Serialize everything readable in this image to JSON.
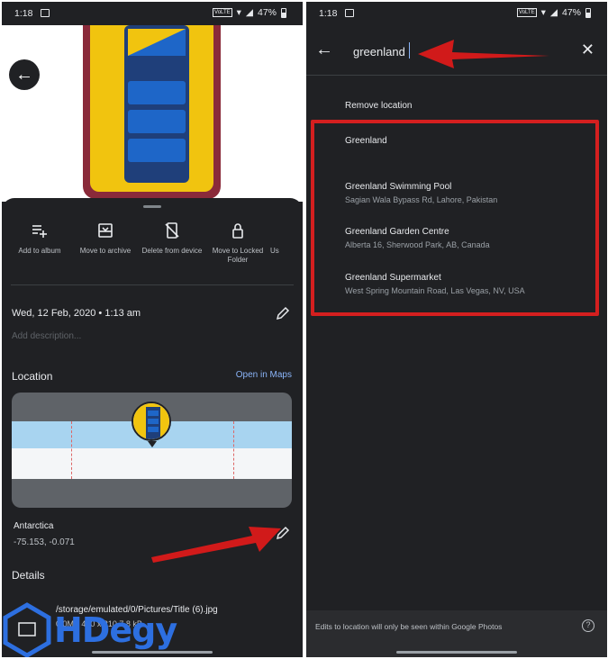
{
  "left_screen": {
    "status": {
      "time": "1:18",
      "battery": "47%",
      "chip": "VoLTE"
    },
    "actions": [
      {
        "label": "Add to album",
        "icon": "playlist-add-icon"
      },
      {
        "label": "Move to archive",
        "icon": "archive-icon"
      },
      {
        "label": "Delete from device",
        "icon": "delete-from-device-icon"
      },
      {
        "label": "Move to Locked Folder",
        "icon": "lock-icon"
      },
      {
        "label": "Us",
        "icon": "more-icon"
      }
    ],
    "date": "Wed, 12 Feb, 2020 • 1:13 am",
    "description_placeholder": "Add description...",
    "location_title": "Location",
    "open_maps": "Open in Maps",
    "location_name": "Antarctica",
    "location_coords": "-75.153, -0.071",
    "details_title": "Details",
    "file_path": "/storage/emulated/0/Pictures/Title (6).jpg",
    "file_meta": "0.0MP  410 x 210  7.8 kB"
  },
  "right_screen": {
    "status": {
      "time": "1:18",
      "battery": "47%",
      "chip": "VoLTE"
    },
    "search": {
      "value": "greenland"
    },
    "remove_location": "Remove location",
    "results": [
      {
        "name": "Greenland",
        "address": ""
      },
      {
        "name": "Greenland Swimming Pool",
        "address": "Sagian Wala Bypass Rd, Lahore, Pakistan"
      },
      {
        "name": "Greenland Garden Centre",
        "address": "Alberta 16, Sherwood Park, AB, Canada"
      },
      {
        "name": "Greenland Supermarket",
        "address": "West Spring Mountain Road, Las Vegas, NV, USA"
      }
    ],
    "footer_note": "Edits to location will only be seen within Google Photos"
  },
  "watermark": "HDegy",
  "colors": {
    "accent_link": "#8ab4f8",
    "highlight_red": "#d41f1f",
    "arrow_red": "#d11a1a",
    "watermark_blue": "#2d6fe0"
  }
}
